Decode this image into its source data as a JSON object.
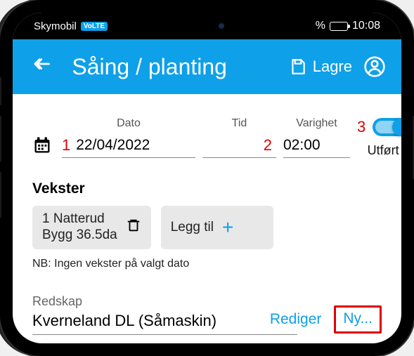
{
  "status": {
    "carrier": "Skymobil",
    "volte": "VoLTE",
    "percent": "%",
    "time": "10:08"
  },
  "header": {
    "title": "Såing / planting",
    "save_label": "Lagre"
  },
  "fields": {
    "date_label": "Dato",
    "date_value": "22/04/2022",
    "time_label": "Tid",
    "time_value": "",
    "duration_label": "Varighet",
    "duration_value": "02:00",
    "done_label": "Utført"
  },
  "annotations": {
    "n1": "1",
    "n2": "2",
    "n3": "3"
  },
  "crops": {
    "section_label": "Vekster",
    "item_line1": "1 Natterud",
    "item_line2": "Bygg  36.5da",
    "add_label": "Legg til",
    "note": "NB: Ingen vekster på valgt dato"
  },
  "equipment": {
    "label": "Redskap",
    "value": "Kverneland DL (Såmaskin)",
    "edit_label": "Rediger",
    "new_label": "Ny..."
  }
}
